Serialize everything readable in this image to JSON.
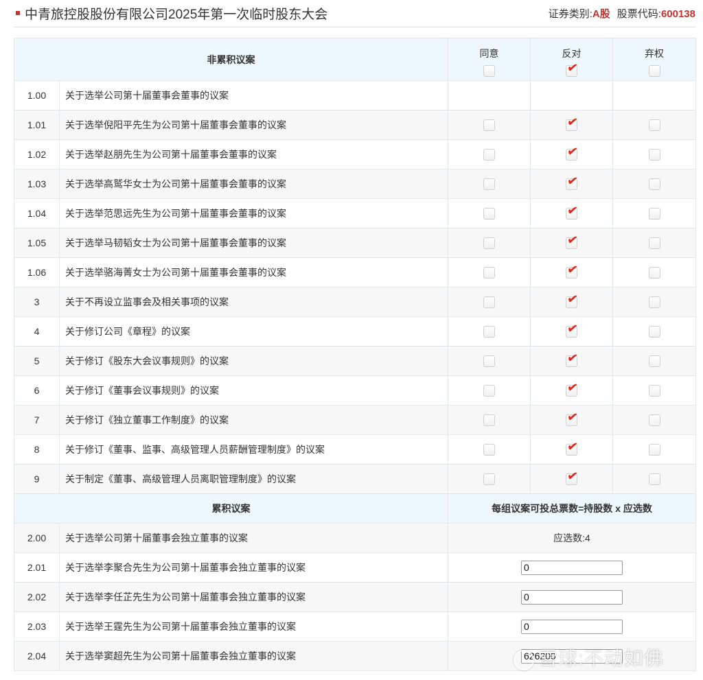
{
  "header": {
    "title": "中青旅控股股份有限公司2025年第一次临时股东大会",
    "security_type_label": "证券类别:",
    "security_type_value": "A股",
    "stock_code_label": "股票代码:",
    "stock_code_value": "600138"
  },
  "table": {
    "non_cumulative_header": "非累积议案",
    "options": [
      "同意",
      "反对",
      "弃权"
    ],
    "header_checks": [
      false,
      true,
      false
    ],
    "non_cumulative_rows": [
      {
        "no": "1.00",
        "name": "关于选举公司第十届董事会董事的议案",
        "has_options": false,
        "checks": [
          false,
          false,
          false
        ]
      },
      {
        "no": "1.01",
        "name": "关于选举倪阳平先生为公司第十届董事会董事的议案",
        "has_options": true,
        "checks": [
          false,
          true,
          false
        ]
      },
      {
        "no": "1.02",
        "name": "关于选举赵朋先生为公司第十届董事会董事的议案",
        "has_options": true,
        "checks": [
          false,
          true,
          false
        ]
      },
      {
        "no": "1.03",
        "name": "关于选举高鹫华女士为公司第十届董事会董事的议案",
        "has_options": true,
        "checks": [
          false,
          true,
          false
        ]
      },
      {
        "no": "1.04",
        "name": "关于选举范思远先生为公司第十届董事会董事的议案",
        "has_options": true,
        "checks": [
          false,
          true,
          false
        ]
      },
      {
        "no": "1.05",
        "name": "关于选举马韧韬女士为公司第十届董事会董事的议案",
        "has_options": true,
        "checks": [
          false,
          true,
          false
        ]
      },
      {
        "no": "1.06",
        "name": "关于选举骆海菁女士为公司第十届董事会董事的议案",
        "has_options": true,
        "checks": [
          false,
          true,
          false
        ]
      },
      {
        "no": "3",
        "name": "关于不再设立监事会及相关事项的议案",
        "has_options": true,
        "checks": [
          false,
          true,
          false
        ]
      },
      {
        "no": "4",
        "name": "关于修订公司《章程》的议案",
        "has_options": true,
        "checks": [
          false,
          true,
          false
        ]
      },
      {
        "no": "5",
        "name": "关于修订《股东大会议事规则》的议案",
        "has_options": true,
        "checks": [
          false,
          true,
          false
        ]
      },
      {
        "no": "6",
        "name": "关于修订《董事会议事规则》的议案",
        "has_options": true,
        "checks": [
          false,
          true,
          false
        ]
      },
      {
        "no": "7",
        "name": "关于修订《独立董事工作制度》的议案",
        "has_options": true,
        "checks": [
          false,
          true,
          false
        ]
      },
      {
        "no": "8",
        "name": "关于修订《董事、监事、高级管理人员薪酬管理制度》的议案",
        "has_options": true,
        "checks": [
          false,
          true,
          false
        ]
      },
      {
        "no": "9",
        "name": "关于制定《董事、高级管理人员离职管理制度》的议案",
        "has_options": true,
        "checks": [
          false,
          true,
          false
        ]
      }
    ],
    "cumulative_header": "累积议案",
    "cumulative_formula": "每组议案可投总票数=持股数 x 应选数",
    "cumulative_rows": [
      {
        "no": "2.00",
        "name": "关于选举公司第十届董事会独立董事的议案",
        "note": "应选数:4"
      },
      {
        "no": "2.01",
        "name": "关于选举李聚合先生为公司第十届董事会独立董事的议案",
        "value": "0"
      },
      {
        "no": "2.02",
        "name": "关于选举李任芷先生为公司第十届董事会独立董事的议案",
        "value": "0"
      },
      {
        "no": "2.03",
        "name": "关于选举王霆先生为公司第十届董事会独立董事的议案",
        "value": "0"
      },
      {
        "no": "2.04",
        "name": "关于选举窦超先生为公司第十届董事会独立董事的议案",
        "value": "626200"
      }
    ]
  },
  "watermark": "雪球:不动如佛",
  "colors": {
    "accent_red": "#c9302c",
    "tick_red": "#e0261b",
    "header_bg": "#eef7fc",
    "border": "#e3e7ea"
  }
}
